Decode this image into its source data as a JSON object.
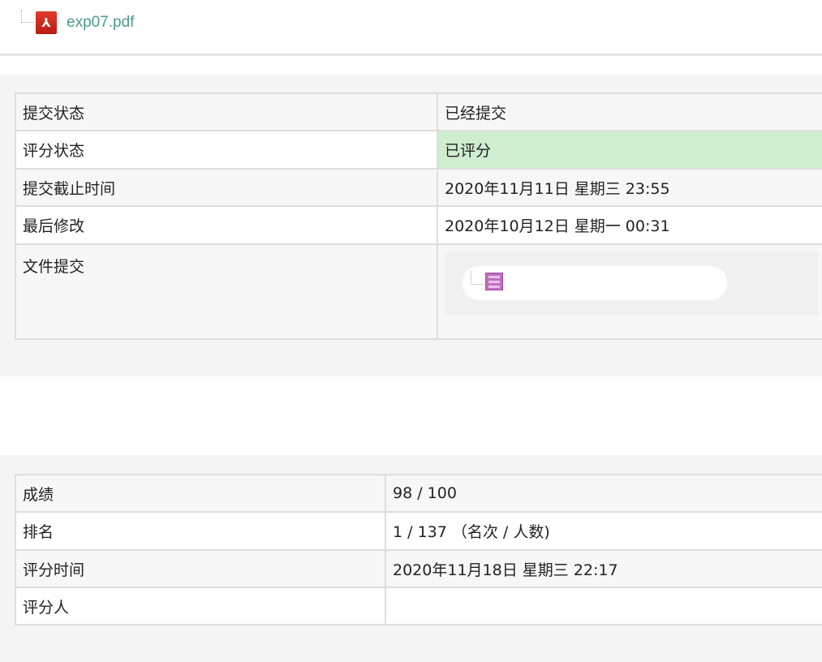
{
  "top_file": {
    "name": "exp07.pdf",
    "icon": "pdf-icon"
  },
  "submission_status": {
    "rows": [
      {
        "label": "提交状态",
        "value": "已经提交"
      },
      {
        "label": "评分状态",
        "value": "已评分"
      },
      {
        "label": "提交截止时间",
        "value": "2020年11月11日 星期三 23:55"
      },
      {
        "label": "最后修改",
        "value": "2020年10月12日 星期一 00:31"
      },
      {
        "label": "文件提交",
        "value": ""
      }
    ],
    "file_icon": "archive-icon",
    "graded_color": "#cfeed0"
  },
  "feedback": {
    "rows": [
      {
        "label": "成绩",
        "value": "98 / 100"
      },
      {
        "label": "排名",
        "value": "1 / 137 （名次 / 人数)"
      },
      {
        "label": "评分时间",
        "value": "2020年11月18日 星期三 22:17"
      },
      {
        "label": "评分人",
        "value": ""
      }
    ]
  },
  "colors": {
    "link": "#4b9b8f",
    "panel_bg": "#f4f4f4"
  }
}
